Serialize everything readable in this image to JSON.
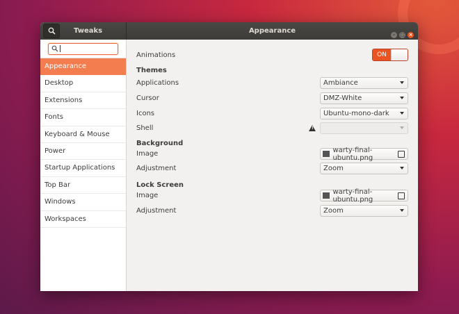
{
  "window": {
    "sidebar_title": "Tweaks",
    "title": "Appearance"
  },
  "sidebar": {
    "search_placeholder": "",
    "items": [
      {
        "label": "Appearance",
        "active": true
      },
      {
        "label": "Desktop"
      },
      {
        "label": "Extensions"
      },
      {
        "label": "Fonts"
      },
      {
        "label": "Keyboard & Mouse"
      },
      {
        "label": "Power"
      },
      {
        "label": "Startup Applications"
      },
      {
        "label": "Top Bar"
      },
      {
        "label": "Windows"
      },
      {
        "label": "Workspaces"
      }
    ]
  },
  "main": {
    "animations": {
      "label": "Animations",
      "toggle": "ON"
    },
    "themes": {
      "header": "Themes",
      "applications": {
        "label": "Applications",
        "value": "Ambiance"
      },
      "cursor": {
        "label": "Cursor",
        "value": "DMZ-White"
      },
      "icons": {
        "label": "Icons",
        "value": "Ubuntu-mono-dark"
      },
      "shell": {
        "label": "Shell",
        "value": ""
      }
    },
    "background": {
      "header": "Background",
      "image": {
        "label": "Image",
        "value": "warty-final-ubuntu.png"
      },
      "adjustment": {
        "label": "Adjustment",
        "value": "Zoom"
      }
    },
    "lock_screen": {
      "header": "Lock Screen",
      "image": {
        "label": "Image",
        "value": "warty-final-ubuntu.png"
      },
      "adjustment": {
        "label": "Adjustment",
        "value": "Zoom"
      }
    }
  },
  "colors": {
    "accent": "#e95420",
    "sidebar_active": "#f47d4f"
  }
}
